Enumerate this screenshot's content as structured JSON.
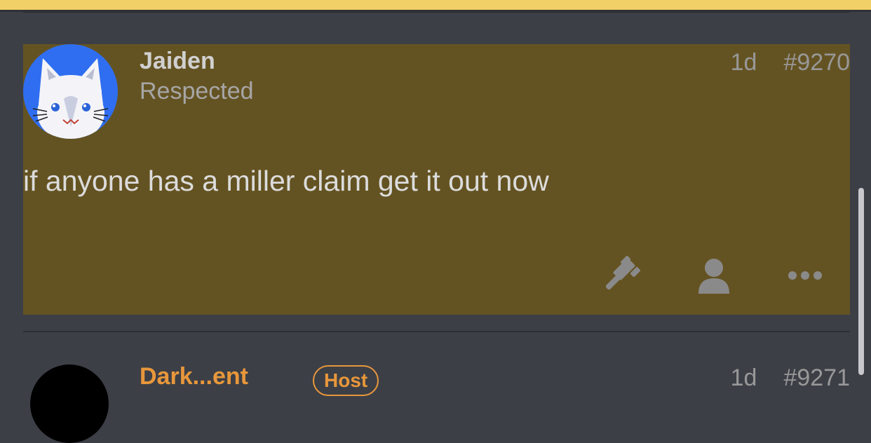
{
  "post": {
    "author": "Jaiden",
    "role": "Respected",
    "age": "1d",
    "number": "#9270",
    "message": "if anyone has a miller claim get it out now",
    "actions": [
      {
        "icon": "gavel-icon"
      },
      {
        "icon": "user-icon"
      },
      {
        "icon": "more-icon"
      }
    ]
  },
  "next_post": {
    "author": "Dark...ent",
    "badge": "Host",
    "age": "1d",
    "number": "#9271"
  },
  "colors": {
    "highlight": "#645322",
    "accent": "#f1d067",
    "host": "#e8973b",
    "avatar_bg": "#2f6ef0"
  }
}
